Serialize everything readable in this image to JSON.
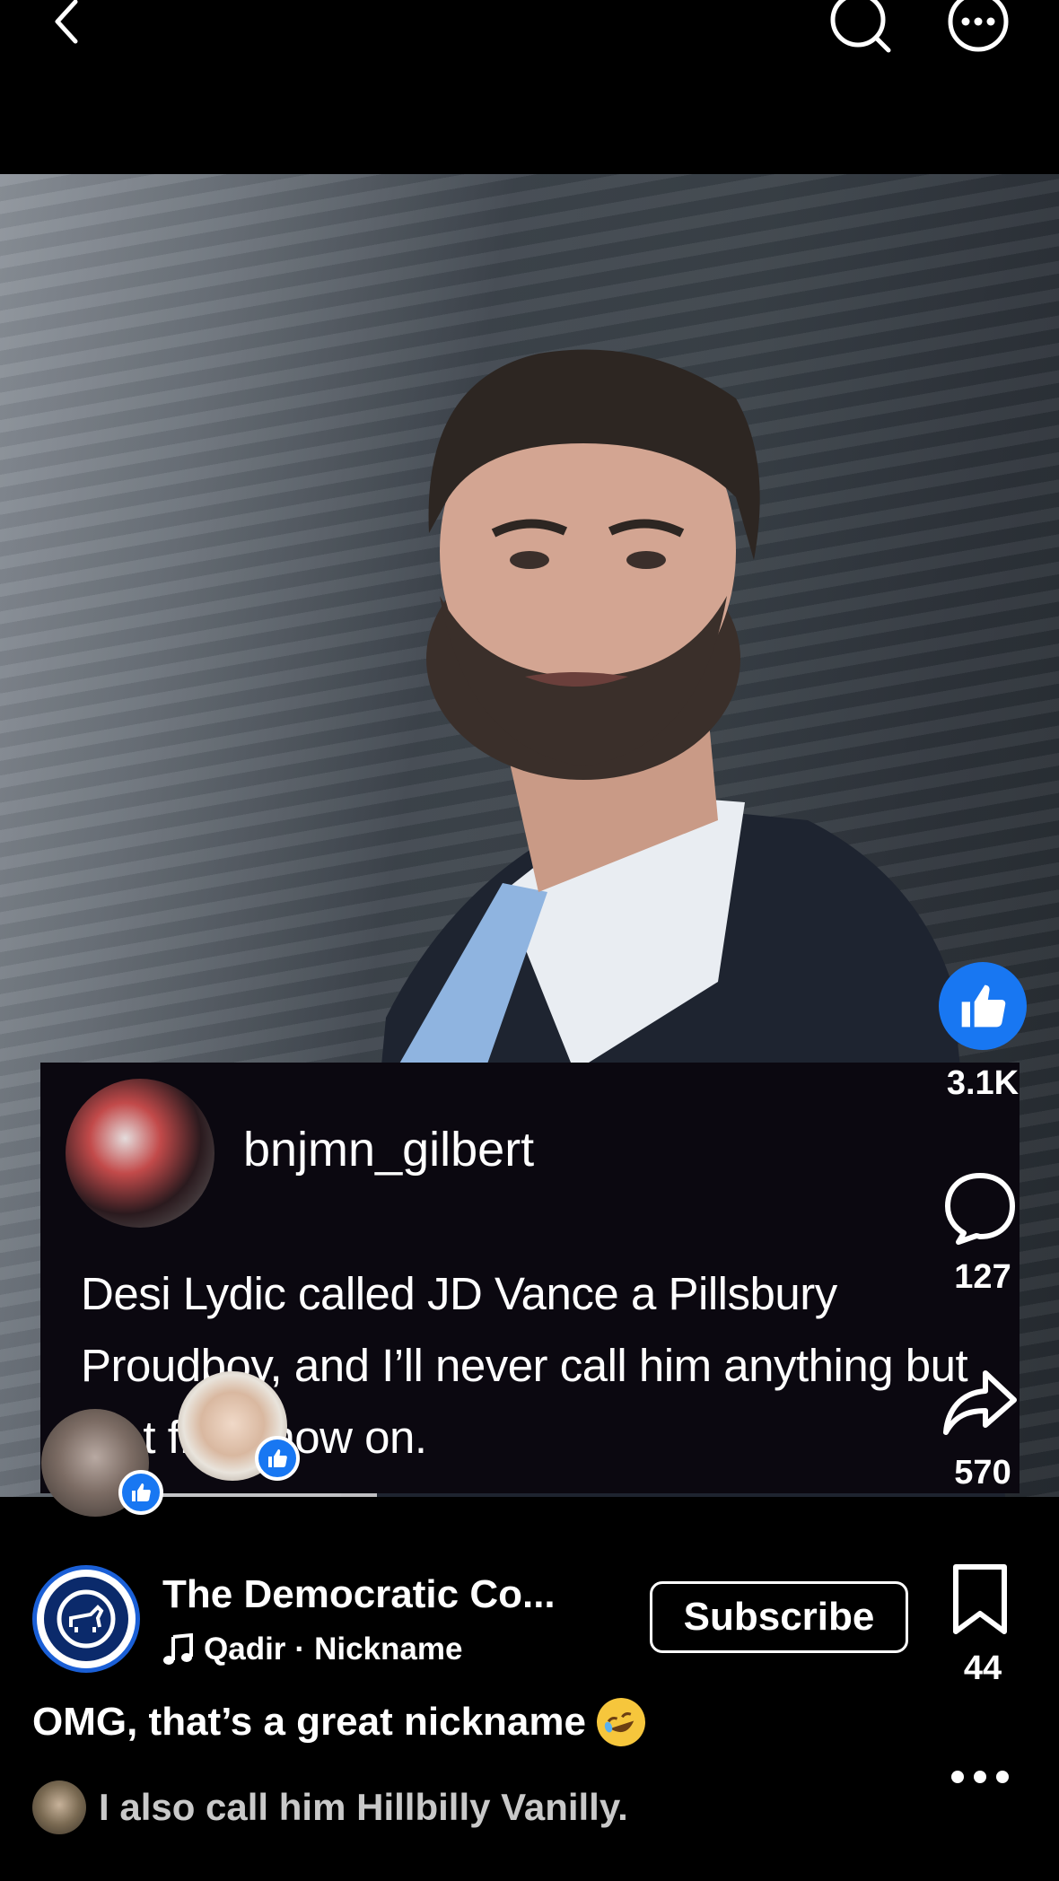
{
  "post": {
    "comment_card": {
      "username": "bnjmn_gilbert",
      "text": "Desi Lydic called JD Vance a Pillsbury Proudboy, and I’ll never call him anything but that from now on."
    },
    "reactions": {
      "likes": "3.1K",
      "comments": "127",
      "shares": "570",
      "saves": "44"
    },
    "channel": {
      "name": "The Democratic Co...",
      "audio_artist": "Qadir",
      "audio_separator": "·",
      "audio_title": "Nickname",
      "subscribe_label": "Subscribe"
    },
    "caption": "OMG, that’s a great nickname",
    "top_comment": "I also call him Hillbilly Vanilly."
  },
  "colors": {
    "like_blue": "#1877f2",
    "background": "#000000",
    "channel_ring": "#1a5fd6"
  },
  "icons": [
    "back-icon",
    "search-icon",
    "more-icon",
    "like-icon",
    "comment-icon",
    "share-icon",
    "bookmark-icon",
    "music-note-icon"
  ]
}
